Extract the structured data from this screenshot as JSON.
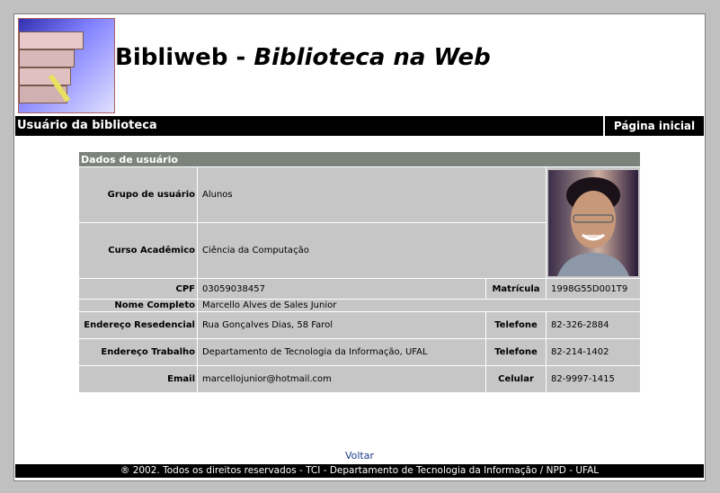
{
  "header": {
    "title_plain": "Bibliweb - ",
    "title_italic": "Biblioteca na Web"
  },
  "navbar": {
    "section": "Usuário da biblioteca",
    "home_link": "Página inicial"
  },
  "user_table": {
    "heading": "Dados de usuário",
    "group_label": "Grupo de usuário",
    "group_value": "Alunos",
    "course_label": "Curso Acadêmico",
    "course_value": "Ciência da Computação",
    "cpf_label": "CPF",
    "cpf_value": "03059038457",
    "matricula_label": "Matrícula",
    "matricula_value": "1998G55D001T9",
    "name_label": "Nome Completo",
    "name_value": "Marcello Alves de Sales Junior",
    "home_address_label": "Endereço Resedencial",
    "home_address_value": "Rua Gonçalves Dias, 58 Farol",
    "home_phone_label": "Telefone",
    "home_phone_value": "82-326-2884",
    "work_address_label": "Endereço Trabalho",
    "work_address_value": "Departamento de Tecnologia da Informação, UFAL",
    "work_phone_label": "Telefone",
    "work_phone_value": "82-214-1402",
    "email_label": "Email",
    "email_value": "marcellojunior@hotmail.com",
    "mobile_label": "Celular",
    "mobile_value": "82-9997-1415"
  },
  "back_link": "Voltar",
  "footer": "® 2002. Todos os direitos reservados - TCI - Departamento de Tecnologia da Informação / NPD - UFAL",
  "colors": {
    "page_bg": "#c0c0c0",
    "bar": "#000000",
    "table_header": "#7b837b",
    "cell": "#c6c6c6",
    "link": "#1a3a8a"
  }
}
